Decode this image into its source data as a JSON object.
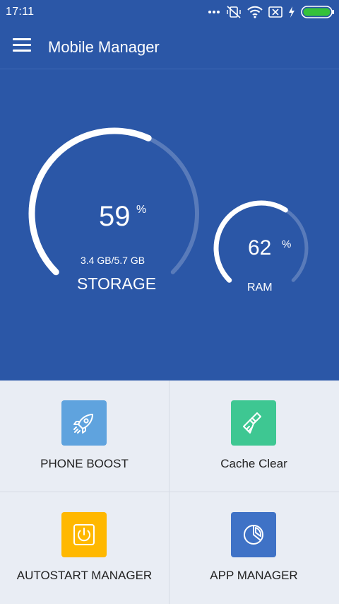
{
  "status_bar": {
    "time": "17:11",
    "icons": [
      "more-dots-icon",
      "vibrate-off-icon",
      "wifi-icon",
      "notification-x-icon",
      "charging-bolt-icon",
      "battery-icon"
    ],
    "battery_color": "#35c23a"
  },
  "header": {
    "title": "Mobile Manager"
  },
  "storage": {
    "percent": "59",
    "percent_symbol": "%",
    "usage": "3.4 GB/5.7 GB",
    "label": "STORAGE",
    "fill_fraction": 0.59
  },
  "ram": {
    "percent": "62",
    "percent_symbol": "%",
    "label": "RAM",
    "fill_fraction": 0.62
  },
  "tools": [
    {
      "label": "PHONE BOOST",
      "icon": "rocket-icon",
      "color": "#5fa3de"
    },
    {
      "label": "Cache Clear",
      "icon": "broom-icon",
      "color": "#3ec792"
    },
    {
      "label": "AUTOSTART MANAGER",
      "icon": "power-icon",
      "color": "#ffb800"
    },
    {
      "label": "APP MANAGER",
      "icon": "pie-chart-icon",
      "color": "#3f72c6"
    }
  ],
  "colors": {
    "primary": "#2b57a7",
    "grid_bg": "#e9edf4"
  }
}
